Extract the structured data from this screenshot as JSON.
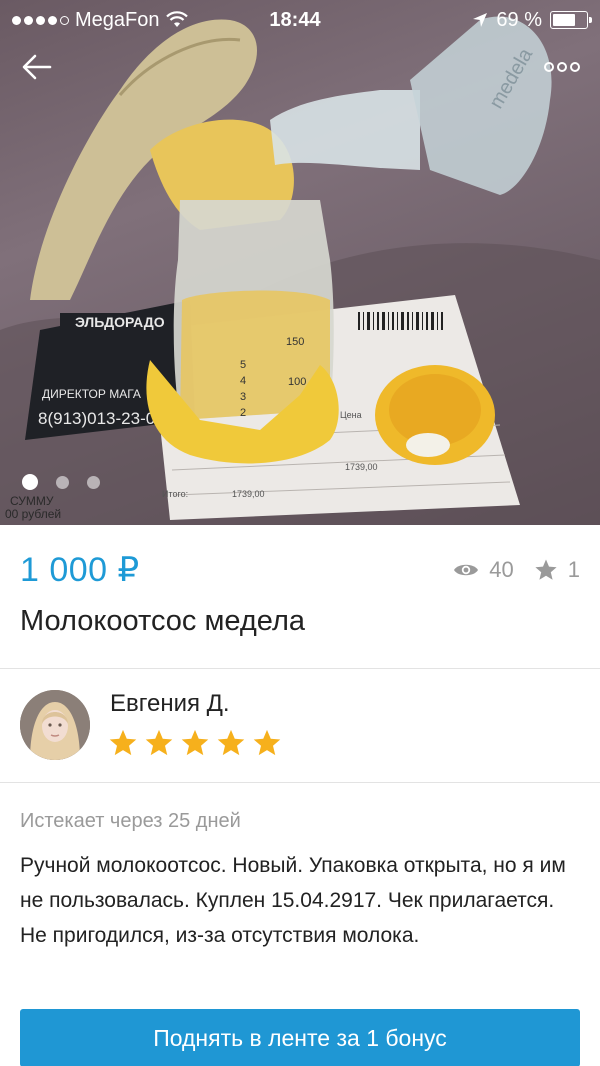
{
  "status_bar": {
    "carrier": "MegaFon",
    "time": "18:44",
    "battery_percent": "69 %",
    "battery_level": 0.69
  },
  "gallery": {
    "photo_count": 3,
    "active_index": 0,
    "photo_text": {
      "store_name": "ЭЛЬДОРАДО",
      "phone": "8(913)013-23-0",
      "director": "ДИРЕКТОР МАГА",
      "bottle_marks": [
        "150",
        "100",
        "5",
        "4",
        "3",
        "2"
      ],
      "receipt_total_label": "Итого:",
      "receipt_total": "1739,00",
      "receipt_amount": "1739,00",
      "receipt_col": "Цена",
      "bonus_text": "СУММУ",
      "rubles": "00 рублей",
      "pump_brand": "medela"
    }
  },
  "listing": {
    "price": "1 000 ₽",
    "views": "40",
    "favorites": "1",
    "title": "Молокоотсос медела"
  },
  "seller": {
    "name": "Евгения Д.",
    "rating": 5,
    "rating_max": 5
  },
  "details": {
    "expires": "Истекает через 25 дней",
    "description": "Ручной молокоотсос. Новый. Упаковка открыта, но я им не пользовалась. Куплен 15.04.2917. Чек прилагается. Не пригодился, из-за отсутствия молока."
  },
  "actions": {
    "boost_label": "Поднять в ленте за 1 бонус"
  },
  "colors": {
    "accent": "#1e9ad6",
    "button": "#1f97d4",
    "star": "#f6b01c",
    "muted": "#9a9a9a"
  }
}
